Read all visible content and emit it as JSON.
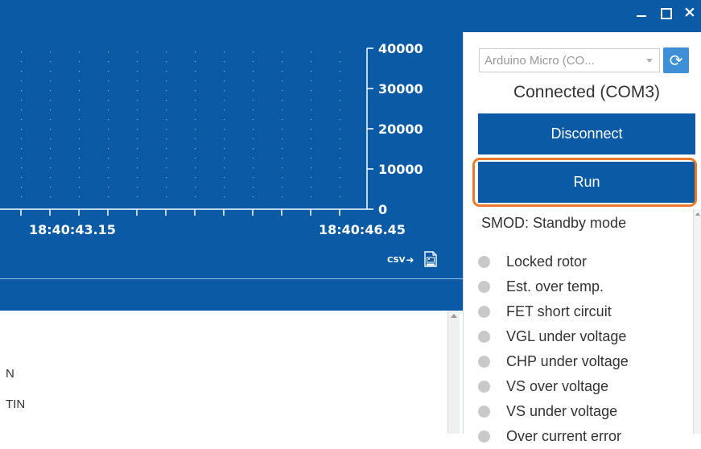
{
  "chart": {
    "y_ticks": [
      "40000",
      "30000",
      "20000",
      "10000",
      "0"
    ],
    "x_ticks": [
      "18:40:43.15",
      "18:40:46.45"
    ],
    "export_csv_label": "CSV"
  },
  "panel": {
    "device_select": {
      "value": "Arduino Micro (CO..."
    },
    "status": "Connected (COM3)",
    "disconnect_label": "Disconnect",
    "run_label": "Run",
    "smod": "SMOD: Standby mode",
    "faults": [
      {
        "label": "Locked rotor"
      },
      {
        "label": "Est. over temp."
      },
      {
        "label": "FET short circuit"
      },
      {
        "label": "VGL under voltage"
      },
      {
        "label": "CHP under voltage"
      },
      {
        "label": "VS over voltage"
      },
      {
        "label": "VS under voltage"
      },
      {
        "label": "Over current error"
      }
    ]
  },
  "lower": {
    "line1": "N",
    "line2": "TIN"
  },
  "colors": {
    "brand_blue": "#0a5aa6",
    "highlight_orange": "#e97a2b",
    "indicator_grey": "#c9c9c9"
  }
}
